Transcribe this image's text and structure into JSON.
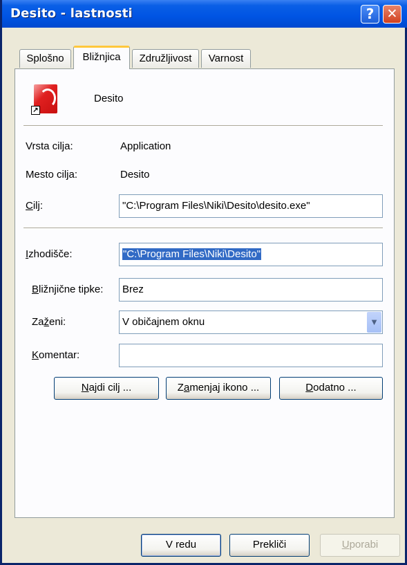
{
  "window": {
    "title": "Desito - lastnosti"
  },
  "titlebar": {
    "help_symbol": "?",
    "close_symbol": "✕"
  },
  "tabs": [
    {
      "label": "Splošno",
      "active": false
    },
    {
      "label": "Bližnjica",
      "active": true
    },
    {
      "label": "Združljivost",
      "active": false
    },
    {
      "label": "Varnost",
      "active": false
    }
  ],
  "app": {
    "name": "Desito",
    "icon": "desito-app-icon",
    "shortcut_overlay": "shortcut-arrow-icon"
  },
  "rows": {
    "target_type_label": "Vrsta cilja:",
    "target_type_value": "Application",
    "target_location_label": "Mesto cilja:",
    "target_location_value": "Desito",
    "target_label_key": "C",
    "target_label_rest": "ilj:",
    "target_value": "\"C:\\Program Files\\Niki\\Desito\\desito.exe\"",
    "start_in_label_key": "I",
    "start_in_label_rest": "zhodišče:",
    "start_in_value": "\"C:\\Program Files\\Niki\\Desito\"",
    "hotkey_label_key": "B",
    "hotkey_label_rest": "ližnjične tipke:",
    "hotkey_value": "Brez",
    "run_label_pre": "Za",
    "run_label_key": "ž",
    "run_label_rest": "eni:",
    "run_value": "V običajnem oknu",
    "comment_label_key": "K",
    "comment_label_rest": "omentar:",
    "comment_value": ""
  },
  "buttons": {
    "find_target_key": "N",
    "find_target_rest": "ajdi cilj ...",
    "change_icon_pre": "Z",
    "change_icon_key": "a",
    "change_icon_rest": "menjaj ikono ...",
    "advanced_key": "D",
    "advanced_rest": "odatno ...",
    "ok": "V redu",
    "cancel": "Prekliči",
    "apply_key": "U",
    "apply_rest": "porabi"
  },
  "colors": {
    "titlebar": "#0054E3",
    "face": "#ECE9D8",
    "selection": "#316AC5",
    "close": "#D2411E"
  }
}
